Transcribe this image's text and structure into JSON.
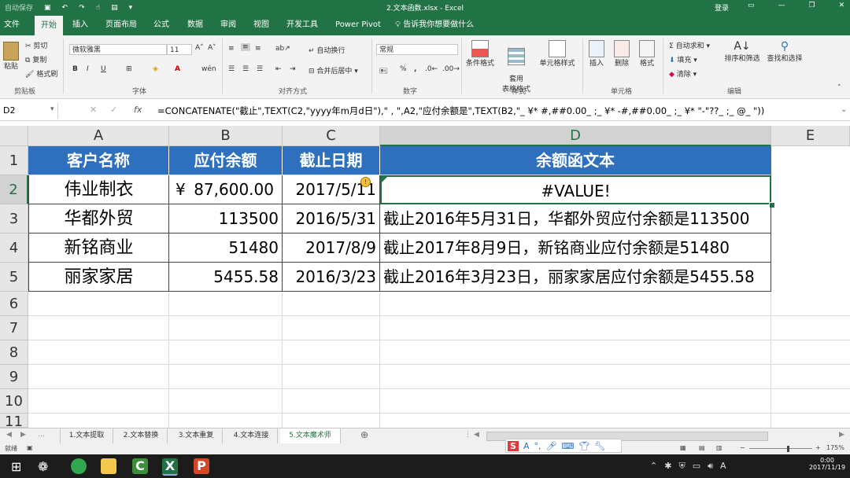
{
  "titlebar": {
    "autosave": "自动保存",
    "title": "2.文本函数.xlsx  -  Excel",
    "login": "登录"
  },
  "tabs": [
    "文件",
    "开始",
    "插入",
    "页面布局",
    "公式",
    "数据",
    "审阅",
    "视图",
    "开发工具",
    "Power Pivot"
  ],
  "active_tab": "开始",
  "tellme": "告诉我你想要做什么",
  "ribbon": {
    "clipboard": {
      "paste": "粘贴",
      "cut": "剪切",
      "copy": "复制",
      "painter": "格式刷",
      "label": "剪贴板"
    },
    "font": {
      "name": "微软雅黑",
      "size": "11",
      "label": "字体"
    },
    "alignment": {
      "wrap": "自动换行",
      "merge": "合并后居中",
      "label": "对齐方式"
    },
    "number": {
      "format": "常规",
      "label": "数字"
    },
    "styles": {
      "conditional": "条件格式",
      "table": "套用\n表格格式",
      "cell": "单元格样式",
      "label": "样式"
    },
    "cells": {
      "insert": "插入",
      "delete": "删除",
      "format": "格式",
      "label": "单元格"
    },
    "editing": {
      "autosum": "自动求和",
      "fill": "填充",
      "clear": "清除",
      "sort": "排序和筛选",
      "find": "查找和选择",
      "label": "编辑"
    }
  },
  "formula_bar": {
    "namebox": "D2",
    "fx": "fx",
    "formula": "=CONCATENATE(\"截止\",TEXT(C2,\"yyyy年m月d日\"),\" , \",A2,\"应付余额是\",TEXT(B2,\"_ ¥* #,##0.00_ ;_ ¥* -#,##0.00_ ;_ ¥* \"-\"??_ ;_ @_ \"))"
  },
  "columns": [
    "A",
    "B",
    "C",
    "D",
    "E"
  ],
  "selected_column": "D",
  "rows": [
    "1",
    "2",
    "3",
    "4",
    "5",
    "6",
    "7",
    "8",
    "9",
    "10",
    "11"
  ],
  "selected_row": "2",
  "table": {
    "headers": [
      "客户名称",
      "应付余额",
      "截止日期",
      "余额函文本"
    ],
    "data": [
      {
        "name": "伟业制衣",
        "currency": "¥",
        "amount": "87,600.00",
        "date": "2017/5/11",
        "text": "#VALUE!"
      },
      {
        "name": "华都外贸",
        "amount": "113500",
        "date": "2016/5/31",
        "text": "截止2016年5月31日，华都外贸应付余额是113500"
      },
      {
        "name": "新铭商业",
        "amount": "51480",
        "date": "2017/8/9",
        "text": "截止2017年8月9日，新铭商业应付余额是51480"
      },
      {
        "name": "丽家家居",
        "amount": "5455.58",
        "date": "2016/3/23",
        "text": "截止2016年3月23日，丽家家居应付余额是5455.58"
      }
    ]
  },
  "sheets": [
    "1.文本提取",
    "2.文本替换",
    "3.文本重复",
    "4.文本连接",
    "5.文本魔术师"
  ],
  "active_sheet": "5.文本魔术师",
  "status": {
    "ready": "就绪",
    "zoom": "175%"
  },
  "taskbar": {
    "time": "0:00",
    "date": "2017/11/19",
    "lang": "A"
  },
  "colors": {
    "excel_green": "#217346",
    "header_blue": "#2e6fbe"
  }
}
